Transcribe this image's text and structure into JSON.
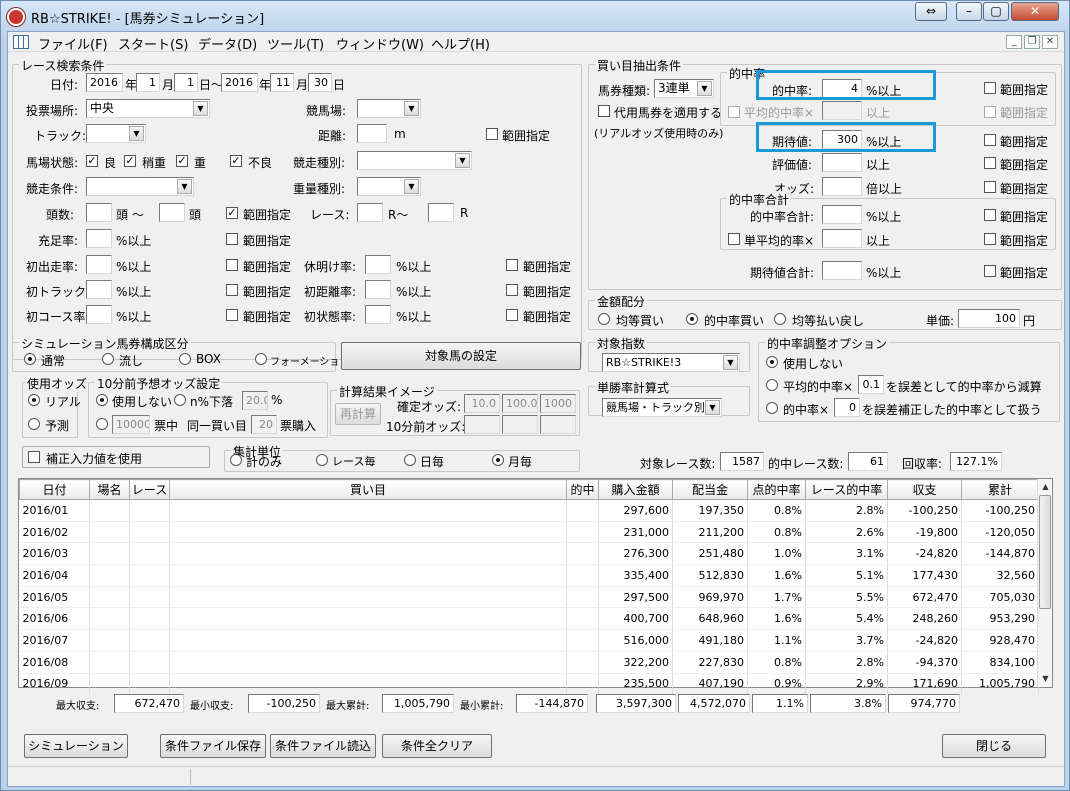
{
  "window": {
    "title": "RB☆STRIKE! - [馬券シミュレーション]"
  },
  "menu": [
    "ファイル(F)",
    "スタート(S)",
    "データ(D)",
    "ツール(T)",
    "ウィンドウ(W)",
    "ヘルプ(H)"
  ],
  "race": {
    "title": "レース検索条件",
    "date_label": "日付:",
    "from_year": "2016",
    "from_month": "1",
    "from_day": "1",
    "to_year": "2016",
    "to_month": "11",
    "to_day": "30",
    "year_unit": "年",
    "month_unit": "月",
    "day_unit_from": "日～",
    "day_unit": "日",
    "venue_label": "投票場所:",
    "venue": "中央",
    "track_label": "競馬場:",
    "course_label": "トラック:",
    "distance_label": "距離:",
    "distance_unit": "m",
    "range_label": "範囲指定",
    "condition_label": "馬場状態:",
    "conditions": [
      "良",
      "稍重",
      "重",
      "不良"
    ],
    "race_type_label": "競走種別:",
    "race_cond_label": "競走条件:",
    "weight_label": "重量種別:",
    "heads_label": "頭数:",
    "heads_unit": "頭 ～",
    "heads_unit2": "頭",
    "race_label": "レース:",
    "race_unit": "R～",
    "race_unit2": "R",
    "fill_label": "充足率:",
    "pct_over": "%以上",
    "first_label": "初出走率:",
    "first_track_label": "初トラック率:",
    "first_course_label": "初コース率:",
    "rest_label": "休明け率:",
    "first_dist_label": "初距離率:",
    "first_state_label": "初状態率:"
  },
  "bet": {
    "title": "買い目抽出条件",
    "type_label": "馬券種類:",
    "type": "3連単",
    "substitute_label": "代用馬券を適用する",
    "substitute_note": "(リアルオッズ使用時のみ)",
    "hit_group": "的中率",
    "hit_rate_label": "的中率:",
    "hit_rate": "4",
    "pct_over": "%以上",
    "avg_hit_label": "平均的中率×",
    "over": "以上",
    "expect_label": "期待値:",
    "expect": "300",
    "eval_label": "評価値:",
    "odds_label": "オッズ:",
    "odds_over": "倍以上",
    "hit_sum_group": "的中率合計",
    "hit_sum_label": "的中率合計:",
    "single_avg_label": "単平均的率×",
    "expect_sum_label": "期待値合計:",
    "range_label": "範囲指定"
  },
  "money": {
    "title": "金額配分",
    "options": [
      "均等買い",
      "的中率買い",
      "均等払い戻し"
    ],
    "unit_label": "単価:",
    "unit": "100",
    "yen": "円"
  },
  "sim": {
    "title": "シミュレーション馬券構成区分",
    "options": [
      "通常",
      "流し",
      "BOX",
      "フォーメーション"
    ],
    "target_button": "対象馬の設定"
  },
  "odds": {
    "title": "使用オッズ",
    "options": [
      "リアル",
      "予測"
    ]
  },
  "pre10": {
    "title": "10分前予想オッズ設定",
    "unused": "使用しない",
    "n_label": "n%下落",
    "n": "20.0",
    "pct": "%",
    "times": "10000",
    "times_label": "票中",
    "same_label": "同一買い目",
    "votes": "20",
    "votes_label": "票購入"
  },
  "calc": {
    "title": "計算結果イメージ",
    "button": "再計算",
    "fixed_label": "確定オッズ:",
    "before_label": "10分前オッズ:",
    "fixed": [
      "10.0",
      "100.0",
      "1000"
    ]
  },
  "correct": {
    "label": "補正入力値を使用"
  },
  "target_index": {
    "title": "対象指数",
    "value": "RB☆STRIKE!3"
  },
  "win_formula": {
    "title": "単勝率計算式",
    "value": "競馬場・トラック別"
  },
  "adjust": {
    "title": "的中率調整オプション",
    "unused": "使用しない",
    "avg_label": "平均的中率×",
    "avg_val": "0.1",
    "avg_suffix": "を誤差として的中率から減算",
    "hit_label": "的中率×",
    "hit_val": "0",
    "hit_suffix": "を誤差補正した的中率として扱う"
  },
  "agg": {
    "title": "集計単位",
    "options": [
      "計のみ",
      "レース毎",
      "日毎",
      "月毎"
    ]
  },
  "stats": {
    "target_label": "対象レース数:",
    "target": "1587",
    "hit_label": "的中レース数:",
    "hit": "61",
    "return_label": "回収率:",
    "return": "127.1%"
  },
  "table": {
    "headers": [
      "日付",
      "場名",
      "レース",
      "買い目",
      "的中",
      "購入金額",
      "配当金",
      "点的中率",
      "レース的中率",
      "収支",
      "累計"
    ],
    "rows": [
      [
        "2016/01",
        "",
        "",
        "",
        "",
        "297,600",
        "197,350",
        "0.8%",
        "2.8%",
        "-100,250",
        "-100,250"
      ],
      [
        "2016/02",
        "",
        "",
        "",
        "",
        "231,000",
        "211,200",
        "0.8%",
        "2.6%",
        "-19,800",
        "-120,050"
      ],
      [
        "2016/03",
        "",
        "",
        "",
        "",
        "276,300",
        "251,480",
        "1.0%",
        "3.1%",
        "-24,820",
        "-144,870"
      ],
      [
        "2016/04",
        "",
        "",
        "",
        "",
        "335,400",
        "512,830",
        "1.6%",
        "5.1%",
        "177,430",
        "32,560"
      ],
      [
        "2016/05",
        "",
        "",
        "",
        "",
        "297,500",
        "969,970",
        "1.7%",
        "5.5%",
        "672,470",
        "705,030"
      ],
      [
        "2016/06",
        "",
        "",
        "",
        "",
        "400,700",
        "648,960",
        "1.6%",
        "5.4%",
        "248,260",
        "953,290"
      ],
      [
        "2016/07",
        "",
        "",
        "",
        "",
        "516,000",
        "491,180",
        "1.1%",
        "3.7%",
        "-24,820",
        "928,470"
      ],
      [
        "2016/08",
        "",
        "",
        "",
        "",
        "322,200",
        "227,830",
        "0.8%",
        "2.8%",
        "-94,370",
        "834,100"
      ],
      [
        "2016/09",
        "",
        "",
        "",
        "",
        "235,500",
        "407,190",
        "0.9%",
        "2.9%",
        "171,690",
        "1,005,790"
      ]
    ]
  },
  "summary": {
    "max_profit_label": "最大収支:",
    "max_profit": "672,470",
    "min_profit_label": "最小収支:",
    "min_profit": "-100,250",
    "max_cum_label": "最大累計:",
    "max_cum": "1,005,790",
    "min_cum_label": "最小累計:",
    "min_cum": "-144,870",
    "buy_total": "3,597,300",
    "payout_total": "4,572,070",
    "point_rate": "1.1%",
    "race_rate": "3.8%",
    "profit_total": "974,770"
  },
  "buttons": {
    "simulate": "シミュレーション",
    "save": "条件ファイル保存",
    "load": "条件ファイル読込",
    "clear": "条件全クリア",
    "close": "閉じる"
  }
}
